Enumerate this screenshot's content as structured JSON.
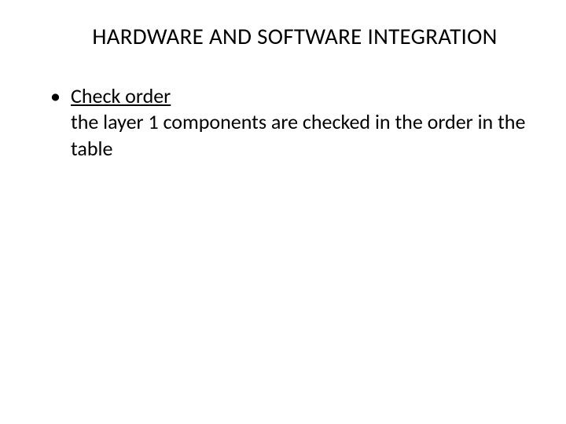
{
  "slide": {
    "title": "HARDWARE AND SOFTWARE INTEGRATION",
    "bullets": [
      {
        "heading": "Check order",
        "body": "the layer 1 components are checked in the order in the table"
      }
    ]
  }
}
